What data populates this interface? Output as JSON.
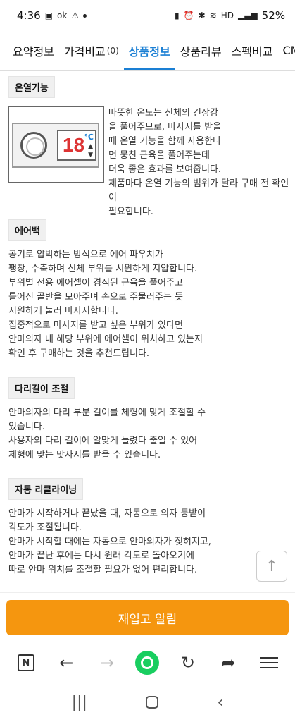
{
  "status": {
    "time": "4:36",
    "battery": "52%",
    "left_icons": [
      "gallery-icon",
      "ok-icon",
      "alert-icon",
      "dot-icon"
    ],
    "right_icons": [
      "battery-saver-icon",
      "alarm-icon",
      "bluetooth-icon",
      "wifi-icon",
      "hd-icon",
      "signal-icon"
    ]
  },
  "tabs": [
    {
      "label": "요약정보",
      "count": ""
    },
    {
      "label": "가격비교",
      "count": "(0)"
    },
    {
      "label": "상품정보",
      "count": "",
      "active": true
    },
    {
      "label": "상품리뷰",
      "count": ""
    },
    {
      "label": "스펙비교",
      "count": ""
    },
    {
      "label": "CM",
      "count": ""
    }
  ],
  "sections": {
    "heat": {
      "title": "온열기능",
      "text": "따뜻한 온도는 신체의 긴장감\n을 풀어주므로, 마사지를 받을\n때 온열 기능을 함께 사용한다\n면 뭉친 근육을 풀어주는데\n더욱 좋은 효과를 보여줍니다.\n제품마다 온열 기능의 범위가 달라 구매 전 확인이\n필요합니다.",
      "image": {
        "temp": "18",
        "unit": "℃",
        "arrows": "▲\n▼"
      }
    },
    "airbag": {
      "title": "에어백",
      "text": "공기로 압박하는 방식으로 에어 파우치가\n팽창, 수축하며 신체 부위를 시원하게 지압합니다.\n부위별 전용 에어셀이 경직된 근육을 풀어주고\n틀어진 골반을 모아주며 손으로 주물러주는 듯\n시원하게 눌러 마사지합니다.\n집중적으로 마사지를 받고 싶은 부위가 있다면\n안마의자 내 해당 부위에 에어셀이 위치하고 있는지\n확인 후 구매하는 것을 추천드립니다."
    },
    "leg": {
      "title": "다리길이 조절",
      "text": "안마의자의 다리 부분 길이를 체형에 맞게 조절할 수\n있습니다.\n사용자의 다리 길이에 알맞게 늘렸다 줄일 수 있어\n체형에 맞는 맛사지를 받을 수 있습니다."
    },
    "recline": {
      "title": "자동 리클라이닝",
      "text": "안마가 시작하거나 끝났을 때, 자동으로 의자 등받이\n각도가 조절됩니다.\n안마가 시작할 때에는 자동으로 안마의자가 젖혀지고,\n안마가 끝난 후에는 다시 원래 각도로 돌아오기에\n따로 안마 위치를 조절할 필요가 없어 편리합니다."
    }
  },
  "scroll_top_icon": "arrow-up-icon",
  "cta_label": "재입고 알림",
  "browser": {
    "n_label": "N"
  },
  "colors": {
    "accent": "#1a7fd4",
    "cta": "#f5960f",
    "green": "#19ce60"
  }
}
